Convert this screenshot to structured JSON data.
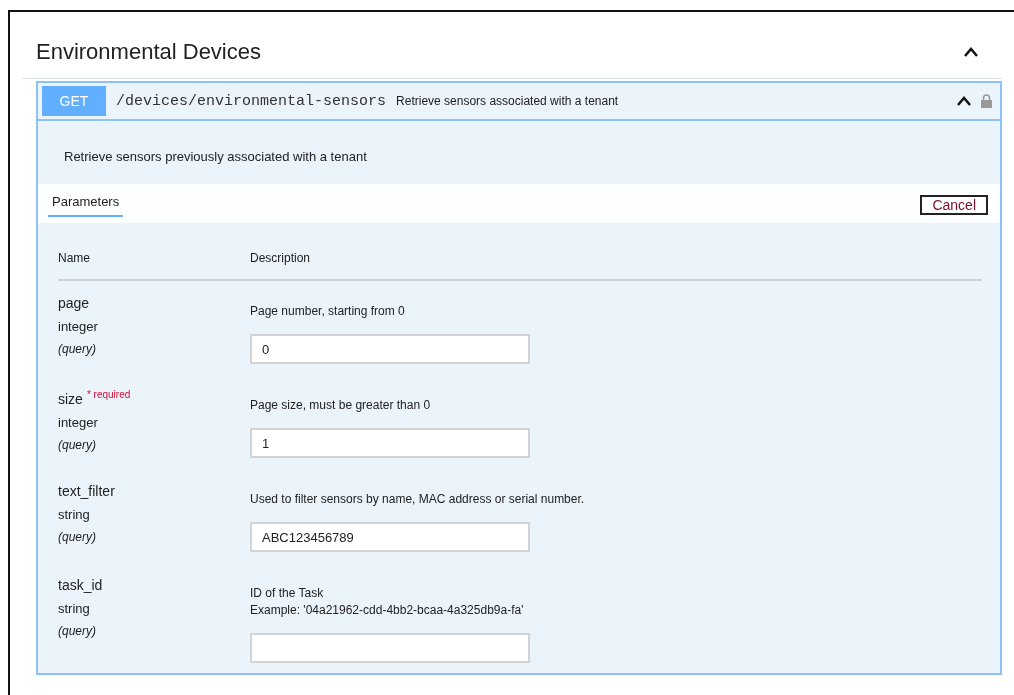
{
  "section": {
    "title": "Environmental Devices",
    "expanded": true
  },
  "operation": {
    "method": "GET",
    "path": "/devices/environmental-sensors",
    "summary": "Retrieve sensors associated with a tenant",
    "expanded": true,
    "locked": true,
    "description": "Retrieve sensors previously associated with a tenant",
    "tabs": [
      {
        "label": "Parameters",
        "selected": true
      }
    ],
    "cancel_button": "Cancel",
    "columns": [
      "Name",
      "Description"
    ],
    "parameters": [
      {
        "name": "page",
        "required": false,
        "type": "integer",
        "in": "(query)",
        "description": [
          "Page number, starting from 0"
        ],
        "value": "0"
      },
      {
        "name": "size",
        "required": true,
        "required_label": "* required",
        "type": "integer",
        "in": "(query)",
        "description": [
          "Page size, must be greater than 0"
        ],
        "value": "1"
      },
      {
        "name": "text_filter",
        "required": false,
        "type": "string",
        "in": "(query)",
        "description": [
          "Used to filter sensors by name, MAC address or serial number."
        ],
        "value": "ABC123456789"
      },
      {
        "name": "task_id",
        "required": false,
        "type": "string",
        "in": "(query)",
        "description": [
          "ID of the Task",
          "Example: '04a21962-cdd-4bb2-bcaa-4a325db9a-fa'"
        ]
      }
    ]
  }
}
